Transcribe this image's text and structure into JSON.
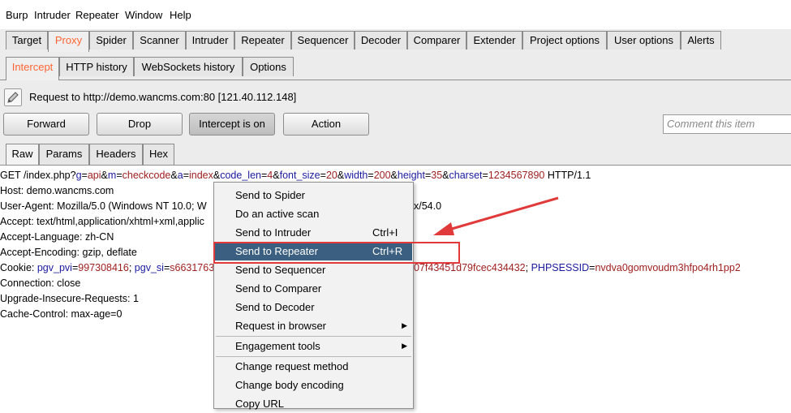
{
  "menubar": [
    "Burp",
    "Intruder",
    "Repeater",
    "Window",
    "Help"
  ],
  "tabs": [
    "Target",
    "Proxy",
    "Spider",
    "Scanner",
    "Intruder",
    "Repeater",
    "Sequencer",
    "Decoder",
    "Comparer",
    "Extender",
    "Project options",
    "User options",
    "Alerts"
  ],
  "subtabs": [
    "Intercept",
    "HTTP history",
    "WebSockets history",
    "Options"
  ],
  "request_line": "Request to http://demo.wancms.com:80  [121.40.112.148]",
  "buttons": {
    "forward": "Forward",
    "drop": "Drop",
    "intercept": "Intercept is on",
    "action": "Action"
  },
  "comment_placeholder": "Comment this item",
  "editor_tabs": [
    "Raw",
    "Params",
    "Headers",
    "Hex"
  ],
  "request": {
    "line1": {
      "method": "GET /index.php?",
      "params": [
        {
          "k": "g",
          "v": "api"
        },
        {
          "k": "m",
          "v": "checkcode"
        },
        {
          "k": "a",
          "v": "index"
        },
        {
          "k": "code_len",
          "v": "4"
        },
        {
          "k": "font_size",
          "v": "20"
        },
        {
          "k": "width",
          "v": "200"
        },
        {
          "k": "height",
          "v": "35"
        },
        {
          "k": "charset",
          "v": "1234567890"
        }
      ],
      "proto": " HTTP/1.1"
    },
    "host": "Host: demo.wancms.com",
    "ua_left": "User-Agent: Mozilla/5.0 (Windows NT 10.0; W",
    "ua_right": "x/54.0",
    "accept": "Accept: text/html,application/xhtml+xml,applic",
    "accept_lang": "Accept-Language: zh-CN",
    "accept_enc": "Accept-Encoding: gzip, deflate",
    "cookie_label": "Cookie: ",
    "cookie_k1": "pgv_pvi",
    "cookie_v1": "997308416",
    "cookie_k2": "pgv_si",
    "cookie_v2": "s6631763",
    "cookie_right_v": "07f43451d79fcec434432",
    "cookie_k3": "PHPSESSID",
    "cookie_v3": "nvdva0gomvoudm3hfpo4rh1pp2",
    "connection": "Connection: close",
    "upgrade": "Upgrade-Insecure-Requests: 1",
    "cache": "Cache-Control: max-age=0"
  },
  "context_menu": [
    {
      "label": "Send to Spider",
      "shortcut": ""
    },
    {
      "label": "Do an active scan",
      "shortcut": ""
    },
    {
      "label": "Send to Intruder",
      "shortcut": "Ctrl+I"
    },
    {
      "label": "Send to Repeater",
      "shortcut": "Ctrl+R"
    },
    {
      "label": "Send to Sequencer",
      "shortcut": ""
    },
    {
      "label": "Send to Comparer",
      "shortcut": ""
    },
    {
      "label": "Send to Decoder",
      "shortcut": ""
    },
    {
      "label": "Request in browser",
      "shortcut": ""
    },
    {
      "label": "Engagement tools",
      "shortcut": ""
    },
    {
      "label": "Change request method",
      "shortcut": ""
    },
    {
      "label": "Change body encoding",
      "shortcut": ""
    },
    {
      "label": "Copy URL",
      "shortcut": ""
    }
  ],
  "colors": {
    "active_tab": "#ff6633",
    "highlight": "#3a5f80",
    "annotation": "#e03a3a",
    "param_key": "#1a1aa0",
    "param_value": "#a02020"
  }
}
